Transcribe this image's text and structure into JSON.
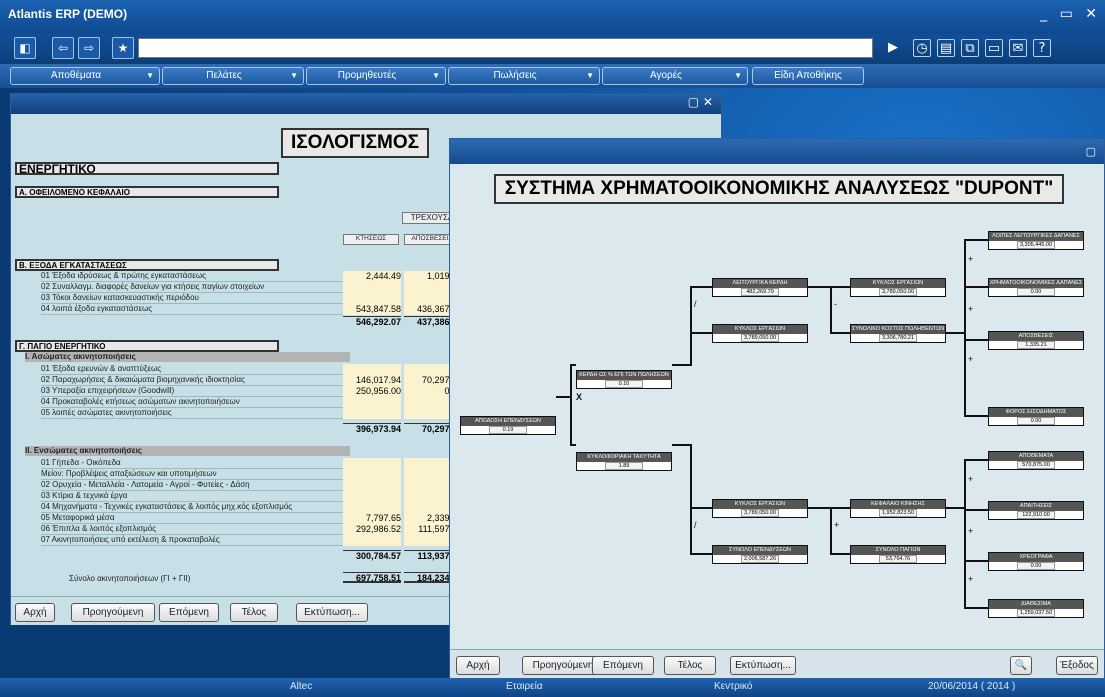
{
  "window": {
    "title": "Atlantis ERP (DEMO)"
  },
  "menus": [
    "Αποθέματα",
    "Πελάτες",
    "Προμηθευτές",
    "Πωλήσεις",
    "Αγορές",
    "Είδη Αποθήκης"
  ],
  "balance": {
    "title": "ΙΣΟΛΟΓΙΣΜΟΣ",
    "section_active": "ΕΝΕΡΓΗΤΙΚΟ",
    "section_a": "Α. ΟΦΕΙΛΟΜΕΝΟ ΚΕΦΑΛΑΙΟ",
    "col_current": "ΤΡΕΧΟΥΣΑ",
    "col_cost": "ΚΤΗΣΕΩΣ",
    "col_depr": "ΑΠΟΣΒΕΣΕΙΣ",
    "section_b": "Β. ΕΞΟΔΑ ΕΓΚΑΤΑΣΤΑΣΕΩΣ",
    "b_rows": [
      {
        "label": "01 Έξοδα ιδρύσεως & πρώτης εγκαταστάσεως",
        "cost": "2,444.49",
        "depr": "1,019.47"
      },
      {
        "label": "02 Συναλλαγμ. διαφορές δανείων για κτήσεις παγίων στοιχείων",
        "cost": "",
        "depr": ""
      },
      {
        "label": "03 Τόκοι δανείων κατασκευαστικής περιόδου",
        "cost": "",
        "depr": ""
      },
      {
        "label": "04 λοιπά έξοδα εγκαταστάσεως",
        "cost": "543,847.58",
        "depr": "436,367.22"
      }
    ],
    "b_total": {
      "cost": "546,292.07",
      "depr": "437,386.69"
    },
    "section_g": "Γ. ΠΑΓΙΟ ΕΝΕΡΓΗΤΙΚΟ",
    "sub_1": "I. Ασώματες ακινητοποιήσεις",
    "g1_rows": [
      {
        "label": "01 Έξοδα ερευνών & αναπτύξεως",
        "cost": "",
        "depr": ""
      },
      {
        "label": "02 Παραχωρήσεις & δικαιώματα βιομηχανικής ιδιοκτησίας",
        "cost": "146,017.94",
        "depr": "70,297.28"
      },
      {
        "label": "03 Υπεραξία επιχειρήσεων (Goodwill)",
        "cost": "250,956.00",
        "depr": "0.00"
      },
      {
        "label": "04 Προκαταβολές κτήσεως ασώματων ακινητοποιήσεων",
        "cost": "",
        "depr": ""
      },
      {
        "label": "05 λοιπές ασώματες ακινητοποιήσεις",
        "cost": "",
        "depr": ""
      }
    ],
    "g1_total": {
      "cost": "396,973.94",
      "depr": "70,297.28"
    },
    "sub_2": "II. Ενσώματες ακινητοποιήσεις",
    "g2_rows": [
      {
        "label": "01 Γήπεδα - Οικόπεδα",
        "cost": "",
        "depr": ""
      },
      {
        "label": "Μείον: Προβλέψεις απαξιώσεων και υποτιμήσεων",
        "cost": "",
        "depr": ""
      },
      {
        "label": "02 Ορυχεία - Μεταλλεία - Λατομεία - Αγροί - Φυτείες - Δάση",
        "cost": "",
        "depr": ""
      },
      {
        "label": "03 Κτίρια & τεχνικά έργα",
        "cost": "",
        "depr": ""
      },
      {
        "label": "04 Μηχανήματα - Τεχνικές εγκαταστάσεις & λοιπός μηχ.κός εξοπλισμός",
        "cost": "",
        "depr": ""
      },
      {
        "label": "05 Μεταφορικά μέσα",
        "cost": "7,797.65",
        "depr": "2,339.29"
      },
      {
        "label": "06 Έπιπλα & λοιπός εξοπλισμός",
        "cost": "292,986.52",
        "depr": "111,597.86"
      },
      {
        "label": "07 Ακινητοποιήσεις υπό εκτέλεση & προκαταβολές",
        "cost": "",
        "depr": ""
      }
    ],
    "g2_total": {
      "cost": "300,784.57",
      "depr": "113,937.15"
    },
    "fixed_total_label": "Σύνολο ακινητοποιήσεων (ΓI + ΓII)",
    "fixed_total": {
      "cost": "697,758.51",
      "depr": "184,234.43"
    }
  },
  "nav1": {
    "first": "Αρχή",
    "prev": "Προηγούμενη",
    "next": "Επόμενη",
    "last": "Τέλος",
    "print": "Εκτύπωση..."
  },
  "dupont": {
    "title": "ΣΥΣΤΗΜΑ ΧΡΗΜΑΤΟΟΙΚΟΝΟΜΙΚΗΣ ΑΝΑΛΥΣΕΩΣ \"DUPONT\"",
    "roi": {
      "label": "ΑΠΟΔΟΣΗ ΕΠΕΝΔΥΣΕΩΝ",
      "value": "0.19"
    },
    "margin": {
      "label": "ΚΕΡΔΗ ΩΣ % ΕΠΙ ΤΩΝ ΠΩΛΗΣΕΩΝ",
      "value": "0.10"
    },
    "turnover": {
      "label": "ΚΥΚΛΟΦΟΡΙΑΚΗ ΤΑΧΥΤΗΤΑ",
      "value": "1.89"
    },
    "op_profit": {
      "label": "ΛΕΙΤΟΥΡΓΙΚΑ ΚΕΡΔΗ",
      "value": "482,269.79"
    },
    "sales1": {
      "label": "ΚΥΚΛΟΣ ΕΡΓΑΣΙΩΝ",
      "value": "3,789,050.00"
    },
    "sales2": {
      "label": "ΚΥΚΛΟΣ ΕΡΓΑΣΙΩΝ",
      "value": "3,789,050.00"
    },
    "sales3": {
      "label": "ΚΥΚΛΟΣ ΕΡΓΑΣΙΩΝ",
      "value": "3,789,050.00"
    },
    "total_cost": {
      "label": "ΣΥΝΟΛΙΚΟ ΚΟΣΤΟΣ ΠΩΛΗΘΕΝΤΩΝ",
      "value": "3,306,780.21"
    },
    "investments": {
      "label": "ΣΥΝΟΛΟ ΕΠΕΝΔΥΣΕΩΝ",
      "value": "2,006,587.26"
    },
    "working_cap": {
      "label": "ΚΕΦΑΛΑΙΟ ΚΙΝΗΣΗΣ",
      "value": "1,952,823.50"
    },
    "fixed_assets": {
      "label": "ΣΥΝΟΛΟ ΠΑΓΙΩΝ",
      "value": "53,764.76"
    },
    "other_exp": {
      "label": "ΛΟΙΠΕΣ ΛΕΙΤΟΥΡΓΙΚΕΣ ΔΑΠΑΝΕΣ",
      "value": "3,305,445.00"
    },
    "fin_exp": {
      "label": "ΧΡΗΜΑΤΟΟΙΚΟΝΟΜΙΚΕΣ ΔΑΠΑΝΕΣ",
      "value": "0.00"
    },
    "depr": {
      "label": "ΑΠΟΣΒΕΣΕΙΣ",
      "value": "1,335.21"
    },
    "tax": {
      "label": "ΦΟΡΟΣ ΕΙΣΟΔΗΜΑΤΟΣ",
      "value": "0.00"
    },
    "inventory": {
      "label": "ΑΠΟΘΕΜΑΤΑ",
      "value": "570,875.00"
    },
    "receivables": {
      "label": "ΑΠΑΙΤΗΣΕΙΣ",
      "value": "122,910.00"
    },
    "securities": {
      "label": "ΧΡΕΟΓΡΑΦΑ",
      "value": "0.00"
    },
    "cash": {
      "label": "ΔΙΑΘΕΣΙΜΑ",
      "value": "1,259,037.50"
    },
    "ops": {
      "x": "X",
      "div": "/",
      "minus": "-",
      "plus": "+"
    }
  },
  "nav2": {
    "first": "Αρχή",
    "prev": "Προηγούμενη",
    "next": "Επόμενη",
    "last": "Τέλος",
    "print": "Εκτύπωση...",
    "exit": "Έξοδος"
  },
  "status": {
    "company": "Altec",
    "type": "Εταιρεία",
    "branch": "Κεντρικό",
    "date": "20/06/2014 ( 2014 )"
  }
}
